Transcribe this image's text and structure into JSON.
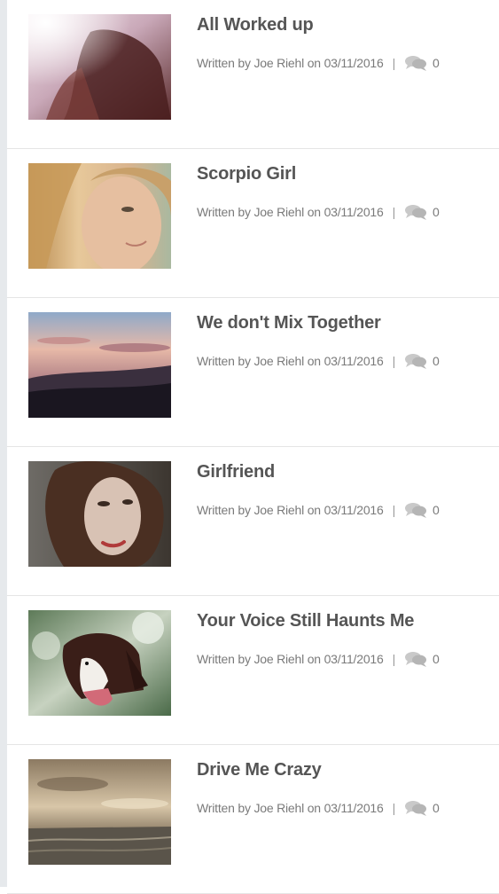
{
  "posts": [
    {
      "title": "All Worked up",
      "meta": "Written by Joe Riehl on 03/11/2016",
      "separator": "|",
      "comments": "0",
      "image": "woman-sunlight-photo"
    },
    {
      "title": "Scorpio Girl",
      "meta": "Written by Joe Riehl on 03/11/2016",
      "separator": "|",
      "comments": "0",
      "image": "blonde-woman-portrait-photo"
    },
    {
      "title": "We don't Mix Together",
      "meta": "Written by Joe Riehl on 03/11/2016",
      "separator": "|",
      "comments": "0",
      "image": "sunset-landscape-photo"
    },
    {
      "title": "Girlfriend",
      "meta": "Written by Joe Riehl on 03/11/2016",
      "separator": "|",
      "comments": "0",
      "image": "woman-portrait-photo"
    },
    {
      "title": "Your Voice Still Haunts Me",
      "meta": "Written by Joe Riehl on 03/11/2016",
      "separator": "|",
      "comments": "0",
      "image": "dog-photo"
    },
    {
      "title": "Drive Me Crazy",
      "meta": "Written by Joe Riehl on 03/11/2016",
      "separator": "|",
      "comments": "0",
      "image": "sea-sky-photo"
    }
  ]
}
